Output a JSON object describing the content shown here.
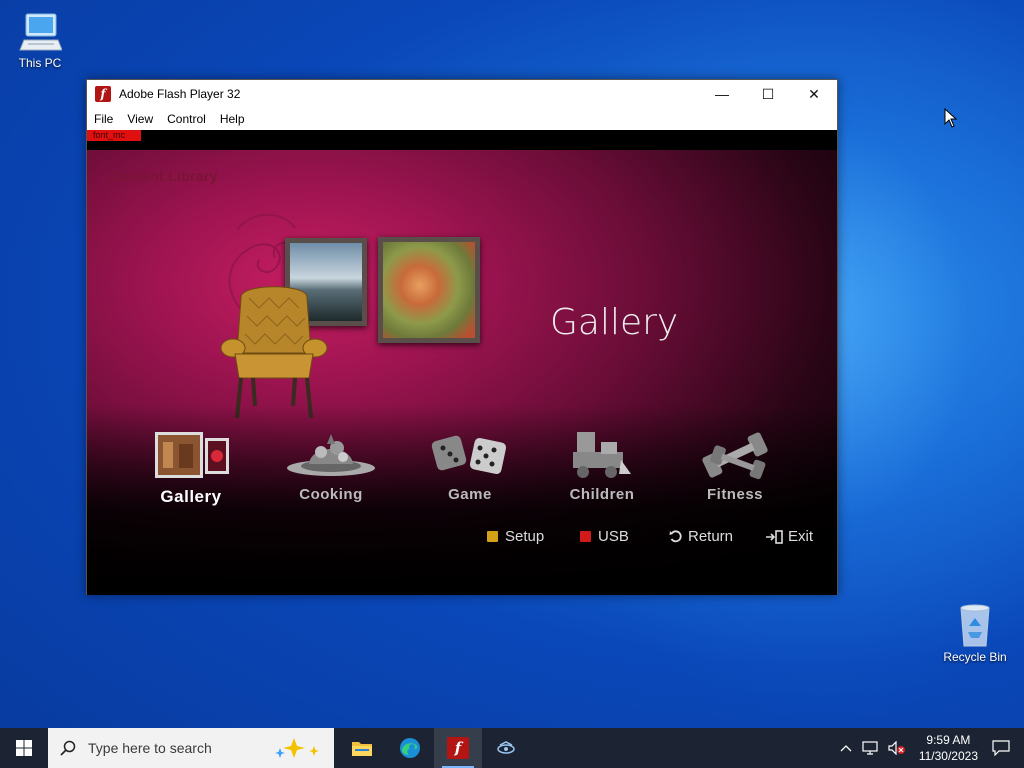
{
  "desktop": {
    "icons": [
      {
        "label": "This PC"
      },
      {
        "label": "Recycle Bin"
      }
    ]
  },
  "window": {
    "title": "Adobe Flash Player 32",
    "app_icon_glyph": "f",
    "controls": {
      "minimize": "—",
      "maximize": "☐",
      "close": "✕"
    },
    "menu": [
      "File",
      "View",
      "Control",
      "Help"
    ]
  },
  "flash": {
    "debug_tag": "font_mc",
    "header": "Content Library",
    "selected_title": "Gallery",
    "categories": [
      {
        "label": "Gallery",
        "icon": "gallery-icon",
        "selected": true
      },
      {
        "label": "Cooking",
        "icon": "cooking-icon",
        "selected": false
      },
      {
        "label": "Game",
        "icon": "dice-icon",
        "selected": false
      },
      {
        "label": "Children",
        "icon": "toy-train-icon",
        "selected": false
      },
      {
        "label": "Fitness",
        "icon": "dumbbell-icon",
        "selected": false
      }
    ],
    "actions": [
      {
        "label": "Setup",
        "color": "#d4a017"
      },
      {
        "label": "USB",
        "color": "#d11a1a"
      },
      {
        "label": "Return",
        "icon": "return-icon"
      },
      {
        "label": "Exit",
        "icon": "exit-icon"
      }
    ]
  },
  "taskbar": {
    "search_placeholder": "Type here to search",
    "clock_time": "9:59 AM",
    "clock_date": "11/30/2023"
  }
}
